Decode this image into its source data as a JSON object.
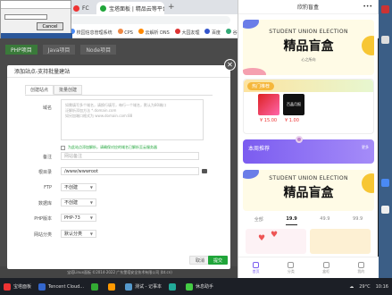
{
  "browser": {
    "tabs": [
      {
        "label": "FC"
      },
      {
        "label": "宝塔面板 | 精品云等平台",
        "active": true
      }
    ],
    "bookmarks": [
      "校园信息管理系统",
      "CPS",
      "云解析 DNS",
      "大园友理",
      "百度",
      "谷歌翻译"
    ]
  },
  "mini_dialog": {
    "cancel_label": "Cancel"
  },
  "page": {
    "tabs": [
      "PHP项目",
      "Java项目",
      "Node项目"
    ],
    "footer": "宝塔Linux面板 ©2014-2022 广东堡塔安全技术有限公司 (bt.cn)"
  },
  "modal": {
    "title": "添加站点-支持批量建站",
    "tabs": [
      "创建站点",
      "批量创建"
    ],
    "fields": {
      "domain_label": "域名",
      "domain_placeholder": "如需填写多个域名，请换行填写，每行一个域名，默认为80端口\n泛解析添加方法 *.domain.com\n如另加端口格式为 www.domain.com:88",
      "checkbox_label": "为此站点添加解析，请确保对应的域名已解析至云服务器",
      "remark_label": "备注",
      "remark_placeholder": "网站备注",
      "root_label": "根目录",
      "root_value": "/www/wwwroot",
      "ftp_label": "FTP",
      "ftp_value": "不创建",
      "db_label": "数据库",
      "db_value": "不创建",
      "php_label": "PHP版本",
      "php_value": "PHP-73",
      "category_label": "网站分类",
      "category_value": "默认分类"
    },
    "cancel_label": "取消",
    "submit_label": "提交"
  },
  "mobile": {
    "header_title": "欣豹盲盒",
    "banner": {
      "en": "STUDENT UNION ELECTION",
      "cn": "精品盲盒",
      "sig": "心之所向"
    },
    "hot_label": "热门推荐",
    "products": [
      {
        "caption": "百晶月报",
        "price": "¥ 15.00"
      },
      {
        "caption": "",
        "price": "¥ 1.00"
      }
    ],
    "rec_title": "本周推荐",
    "rec_more": "更多",
    "banner2": {
      "en": "STUDENT UNION ELECTION",
      "cn": "精品盲盒"
    },
    "categories": [
      "全部",
      "19.9",
      "49.9",
      "99.9"
    ],
    "nav": [
      "首页",
      "分类",
      "盒柜",
      "我的"
    ]
  },
  "taskbar": {
    "items": [
      "宝塔面板",
      "Tencent Cloud...",
      "",
      "",
      "测试 - 记事本",
      "",
      "休息助手"
    ],
    "weather": "29°C",
    "time": "10:16"
  },
  "colors": {
    "accent_green": "#20a53a",
    "purple": "#7b5cf0",
    "yellow": "#f7c634"
  }
}
